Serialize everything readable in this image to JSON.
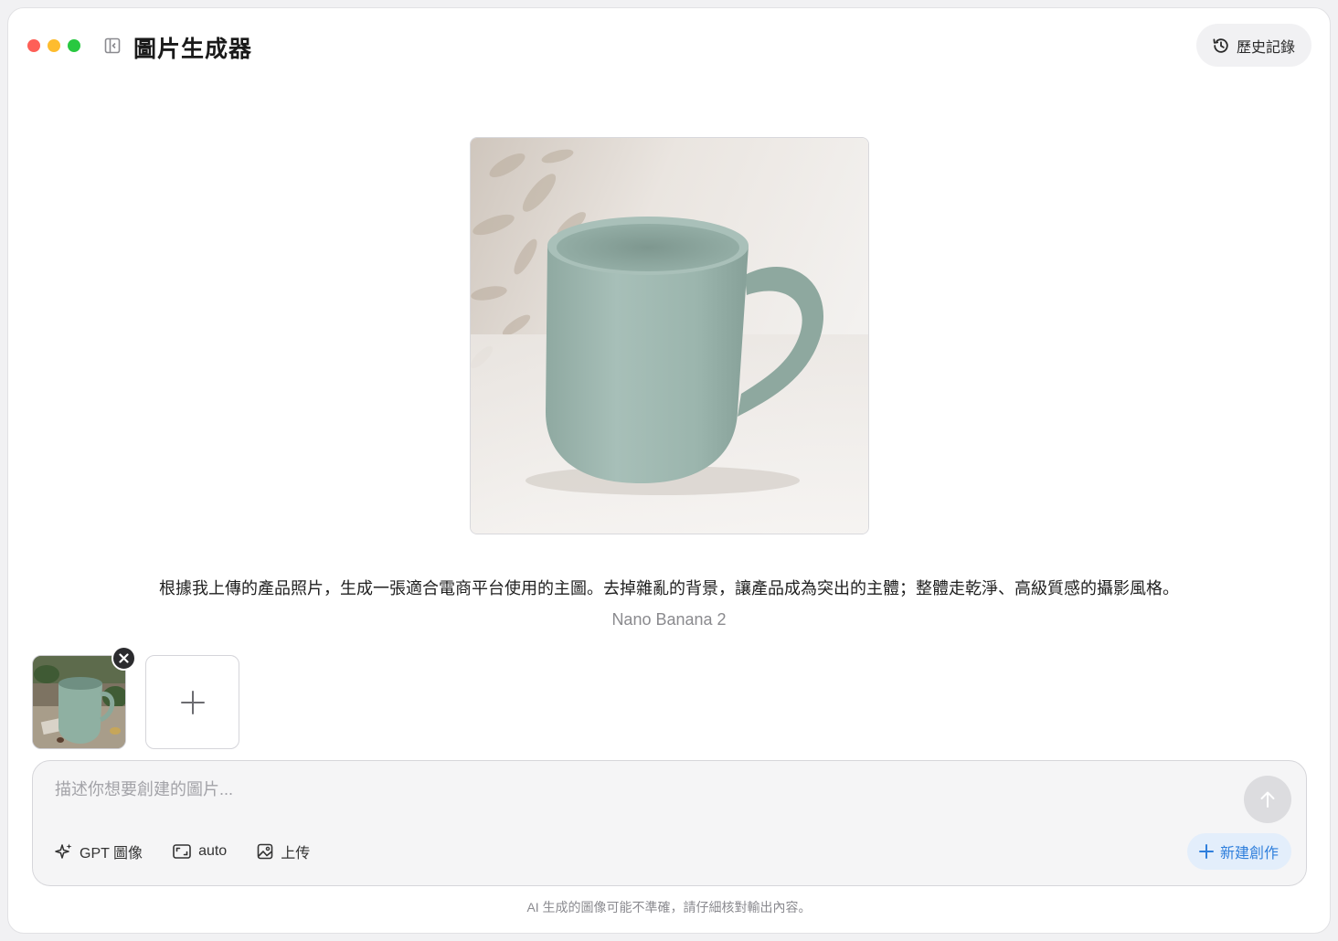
{
  "app": {
    "title": "圖片生成器"
  },
  "header": {
    "history_label": "歷史記錄"
  },
  "result": {
    "image_icon": "mug-photo",
    "prompt": "根據我上傳的產品照片，生成一張適合電商平台使用的主圖。去掉雜亂的背景，讓產品成為突出的主體；整體走乾淨、高級質感的攝影風格。",
    "model": "Nano Banana 2"
  },
  "attachments": {
    "thumb_icon": "mug-source-photo"
  },
  "composer": {
    "placeholder": "描述你想要創建的圖片...",
    "model_label": "GPT 圖像",
    "ratio_label": "auto",
    "upload_label": "上传",
    "new_label": "新建創作"
  },
  "footer": {
    "disclaimer": "AI 生成的圖像可能不準確，請仔細核對輸出內容。"
  },
  "colors": {
    "accent": "#2f7fdc",
    "dot_red": "#fe5f57",
    "dot_yellow": "#febc2e",
    "dot_green": "#28c840",
    "mug": "#9bb5ad"
  }
}
